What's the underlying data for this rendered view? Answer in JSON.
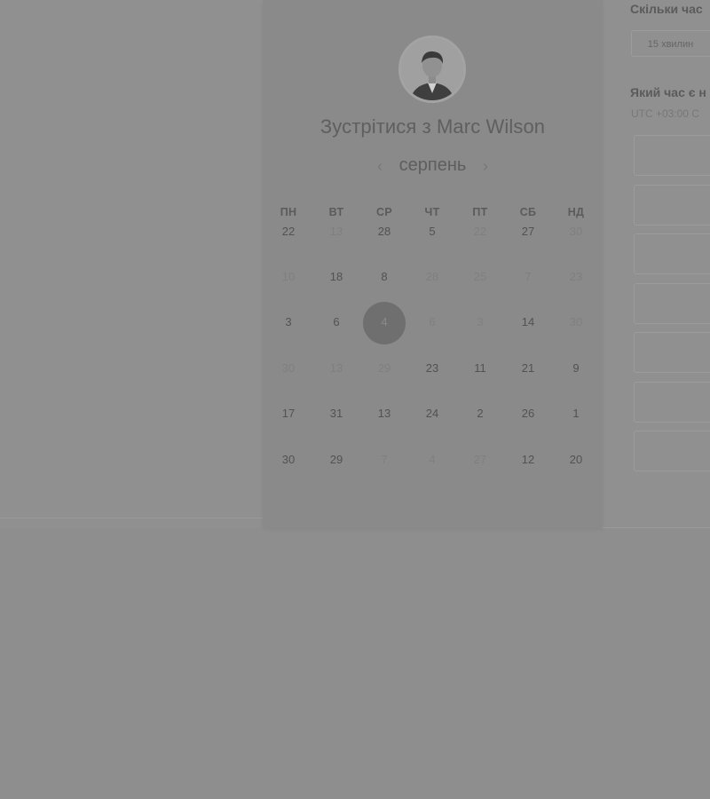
{
  "booking": {
    "title": "Зустрітися з Marc Wilson",
    "month": "серпень",
    "weekdays": [
      "ПН",
      "ВТ",
      "СР",
      "ЧТ",
      "ПТ",
      "СБ",
      "НД"
    ],
    "weeks": [
      [
        {
          "d": "22"
        },
        {
          "d": "13",
          "muted": true
        },
        {
          "d": "28"
        },
        {
          "d": "5"
        },
        {
          "d": "22",
          "muted": true
        },
        {
          "d": "27"
        },
        {
          "d": "30",
          "muted": true
        }
      ],
      [
        {
          "d": "10",
          "muted": true
        },
        {
          "d": "18"
        },
        {
          "d": "8"
        },
        {
          "d": "28",
          "muted": true
        },
        {
          "d": "25",
          "muted": true
        },
        {
          "d": "7",
          "muted": true
        },
        {
          "d": "23",
          "muted": true
        }
      ],
      [
        {
          "d": "3"
        },
        {
          "d": "6"
        },
        {
          "d": "4",
          "selected": true
        },
        {
          "d": "6",
          "muted": true
        },
        {
          "d": "3",
          "muted": true
        },
        {
          "d": "14"
        },
        {
          "d": "30",
          "muted": true
        }
      ],
      [
        {
          "d": "30",
          "muted": true
        },
        {
          "d": "13",
          "muted": true
        },
        {
          "d": "29",
          "muted": true
        },
        {
          "d": "23"
        },
        {
          "d": "11"
        },
        {
          "d": "21"
        },
        {
          "d": "9"
        }
      ],
      [
        {
          "d": "17"
        },
        {
          "d": "31"
        },
        {
          "d": "13"
        },
        {
          "d": "24"
        },
        {
          "d": "2"
        },
        {
          "d": "26"
        },
        {
          "d": "1"
        }
      ],
      [
        {
          "d": "30"
        },
        {
          "d": "29"
        },
        {
          "d": "7",
          "muted": true
        },
        {
          "d": "4",
          "muted": true
        },
        {
          "d": "27",
          "muted": true
        },
        {
          "d": "12"
        },
        {
          "d": "20"
        }
      ]
    ]
  },
  "right_panel": {
    "duration_heading": "Скільки час",
    "duration_option": "15 хвилин",
    "time_heading": "Який час є н",
    "timezone": "UTC +03:00 С",
    "slot_count": 7
  },
  "icons": {
    "prev": "chevron-left-icon",
    "next": "chevron-right-icon"
  }
}
